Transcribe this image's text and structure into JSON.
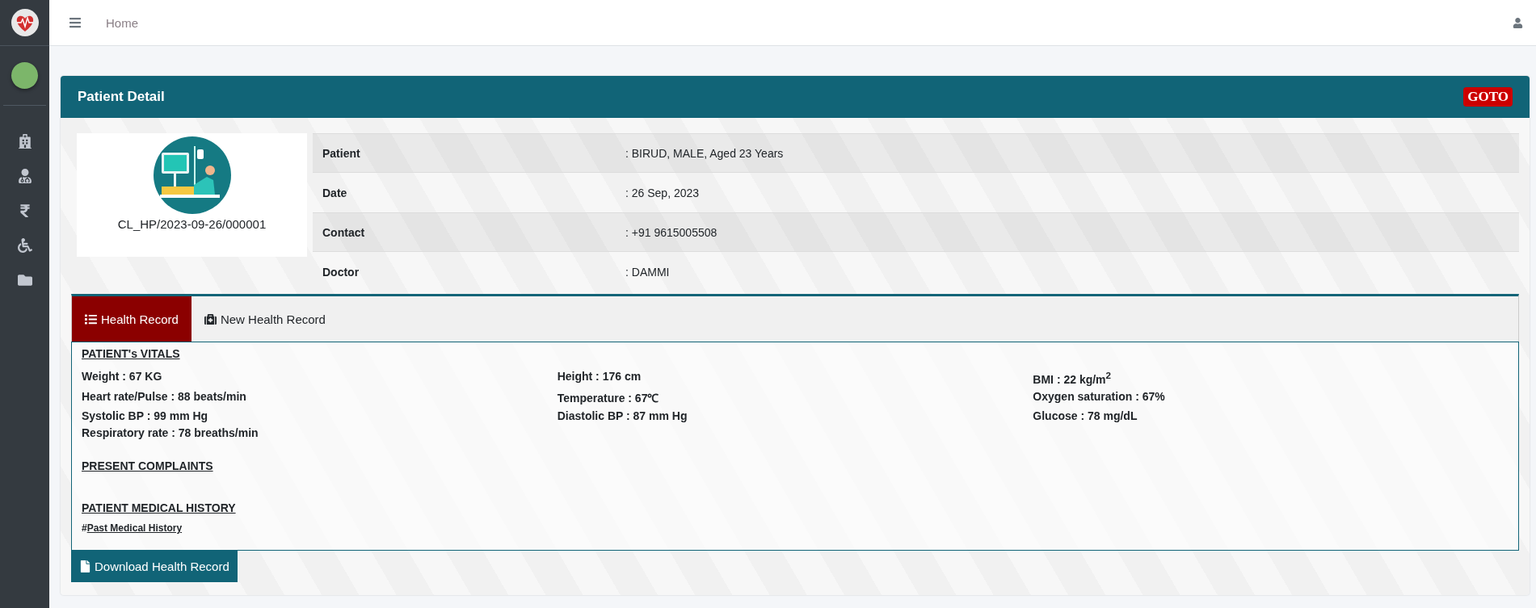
{
  "topbar": {
    "breadcrumb": "Home"
  },
  "card": {
    "title": "Patient Detail",
    "goto_button": "GOTO",
    "patient_id": "CL_HP/2023-09-26/000001",
    "details": [
      {
        "label": "Patient",
        "value": ": BIRUD, MALE, Aged 23 Years"
      },
      {
        "label": "Date",
        "value": ": 26 Sep, 2023"
      },
      {
        "label": "Contact",
        "value": ": +91 9615005508"
      },
      {
        "label": "Doctor",
        "value": ": DAMMI"
      }
    ],
    "tabs": [
      {
        "label": "Health Record",
        "selected": true
      },
      {
        "label": "New Health Record",
        "selected": false
      }
    ],
    "vitals_title": "PATIENT's VITALS",
    "vitals": [
      "Weight : 67 KG",
      "Height : 176 cm",
      "BMI : 22 kg/m$^{2}$",
      "Heart rate/Pulse : 88 beats/min",
      "Temperature : 67℃",
      "Oxygen saturation : 67%",
      "Systolic BP : 99 mm Hg",
      "Diastolic BP : 87 mm Hg",
      "Glucose : 78 mg/dL",
      "Respiratory rate : 78 breaths/min"
    ],
    "complaints_title": "PRESENT COMPLAINTS",
    "history_title": "PATIENT MEDICAL HISTORY",
    "history_items": [
      {
        "marker": "#",
        "title": "Past Medical History"
      }
    ],
    "download_button": "Download Health Record"
  }
}
